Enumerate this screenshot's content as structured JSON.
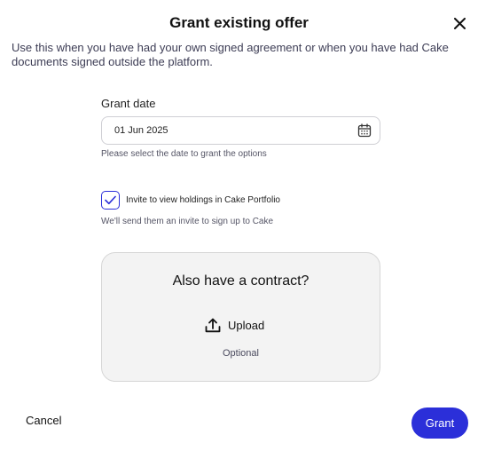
{
  "dialog": {
    "title": "Grant existing offer",
    "description": "Use this when you have had your own signed agreement or when you have had Cake documents signed outside the platform.",
    "close_icon": "close-icon"
  },
  "grant_date": {
    "label": "Grant date",
    "value": "01 Jun 2025",
    "helper": "Please select the date to grant the options",
    "icon": "calendar-icon"
  },
  "invite": {
    "checked": true,
    "label": "Invite to view holdings in Cake Portfolio",
    "helper": "We'll send them an invite to sign up to Cake"
  },
  "contract": {
    "title": "Also have a contract?",
    "upload_label": "Upload",
    "upload_icon": "upload-icon",
    "optional_label": "Optional"
  },
  "footer": {
    "cancel_label": "Cancel",
    "grant_label": "Grant"
  },
  "colors": {
    "accent": "#2b2fd9",
    "card_background": "#f3f3f3"
  }
}
